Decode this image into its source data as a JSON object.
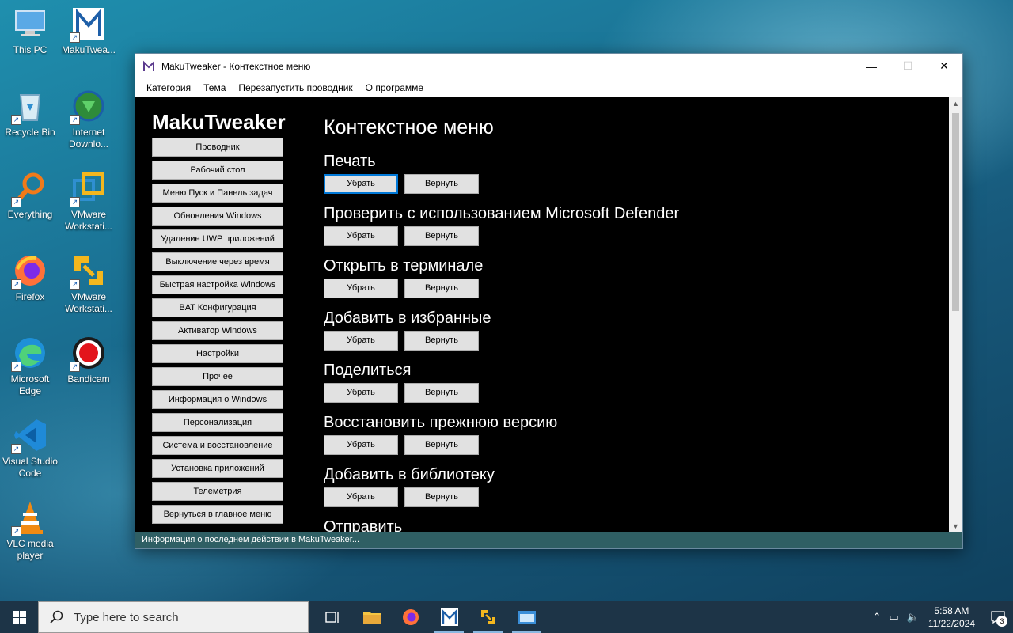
{
  "desktop": {
    "icons": [
      {
        "label": "This PC"
      },
      {
        "label": "MakuTwea..."
      },
      {
        "label": "Recycle Bin"
      },
      {
        "label": "Internet Downlo..."
      },
      {
        "label": "Everything"
      },
      {
        "label": "VMware Workstati..."
      },
      {
        "label": "Firefox"
      },
      {
        "label": "VMware Workstati..."
      },
      {
        "label": "Microsoft Edge"
      },
      {
        "label": "Bandicam"
      },
      {
        "label": "Visual Studio Code"
      },
      {
        "label": "VLC media player"
      }
    ]
  },
  "window": {
    "title": "MakuTweaker - Контекстное меню",
    "controls": {
      "minimize": "—",
      "maximize": "☐",
      "close": "✕"
    },
    "menu": [
      "Категория",
      "Тема",
      "Перезапустить проводник",
      "О программе"
    ],
    "brand": "MakuTweaker",
    "nav": [
      "Проводник",
      "Рабочий стол",
      "Меню Пуск и Панель задач",
      "Обновления Windows",
      "Удаление UWP приложений",
      "Выключение через время",
      "Быстрая настройка Windows",
      "BAT Конфигурация",
      "Активатор Windows",
      "Настройки",
      "Прочее",
      "Информация о Windows",
      "Персонализация",
      "Система и восстановление",
      "Установка приложений",
      "Телеметрия",
      "Вернуться в главное меню"
    ],
    "page_title": "Контекстное меню",
    "remove_label": "Убрать",
    "restore_label": "Вернуть",
    "sections": [
      "Печать",
      "Проверить с использованием Microsoft Defender",
      "Открыть в терминале",
      "Добавить в избранные",
      "Поделиться",
      "Восстановить прежнюю версию",
      "Добавить в библиотеку",
      "Отправить"
    ],
    "status": "Информация о последнем действии в MakuTweaker..."
  },
  "taskbar": {
    "search_placeholder": "Type here to search",
    "time": "5:58 AM",
    "date": "11/22/2024",
    "notification_count": "3"
  }
}
